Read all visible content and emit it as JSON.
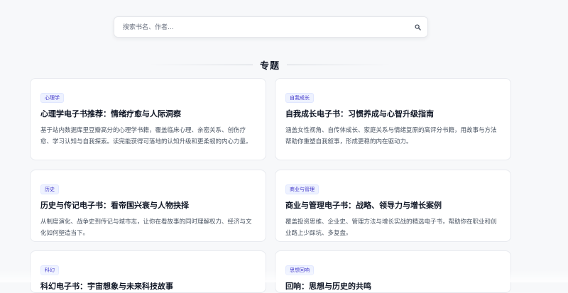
{
  "search": {
    "placeholder": "搜索书名、作者..."
  },
  "section": {
    "title": "专题"
  },
  "cards": [
    {
      "tag": "心理学",
      "title": "心理学电子书推荐：情绪疗愈与人际洞察",
      "desc": "基于站内数据库里豆瓣高分的心理学书籍，覆盖临床心理、亲密关系、创伤疗愈、学习认知与自我探索。读完能获得可落地的认知升级和更柔韧的内心力量。"
    },
    {
      "tag": "自我成长",
      "title": "自我成长电子书：习惯养成与心智升级指南",
      "desc": "涵盖女性视角、自传体成长、家庭关系与情绪复原的高评分书籍，用故事与方法帮助你重塑自我叙事，形成更稳的内在驱动力。"
    },
    {
      "tag": "历史",
      "title": "历史与传记电子书：看帝国兴衰与人物抉择",
      "desc": "从制度演化、战争史到传记与城市志，让你在看故事的同时理解权力、经济与文化如何塑造当下。"
    },
    {
      "tag": "商业与管理",
      "title": "商业与管理电子书：战略、领导力与增长案例",
      "desc": "覆盖投资思维、企业史、管理方法与增长实战的精选电子书，帮助你在职业和创业路上少踩坑、多复盘。"
    },
    {
      "tag": "科幻",
      "title": "科幻电子书：宇宙想象与未来科技故事",
      "desc": ""
    },
    {
      "tag": "思想回响",
      "title": "回响：思想与历史的共鸣",
      "desc": ""
    }
  ]
}
